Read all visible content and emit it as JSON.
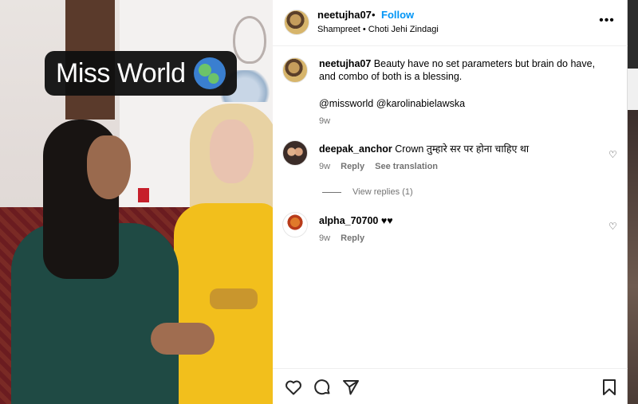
{
  "media": {
    "overlay_text": "Miss World",
    "overlay_icon": "globe-americas-icon"
  },
  "header": {
    "username": "neetujha07",
    "separator": "•",
    "follow_label": "Follow",
    "subtitle": "Shampreet • Choti Jehi Zindagi",
    "more_icon": "more-horizontal-icon"
  },
  "caption": {
    "username": "neetujha07",
    "text": "Beauty have no set parameters but brain do have, and combo of both is a blessing.",
    "mentions": "@missworld @karolinabielawska",
    "time": "9w"
  },
  "comments": [
    {
      "username": "deepak_anchor",
      "text": "Crown तुम्हारे सर पर होना चाहिए था",
      "time": "9w",
      "reply_label": "Reply",
      "translate_label": "See translation"
    },
    {
      "username": "alpha_70700",
      "text": "♥♥",
      "time": "9w",
      "reply_label": "Reply"
    }
  ],
  "view_replies_label": "View replies (1)",
  "colors": {
    "follow": "#0095f6",
    "mention_link": "#00376b",
    "meta": "#737373"
  }
}
